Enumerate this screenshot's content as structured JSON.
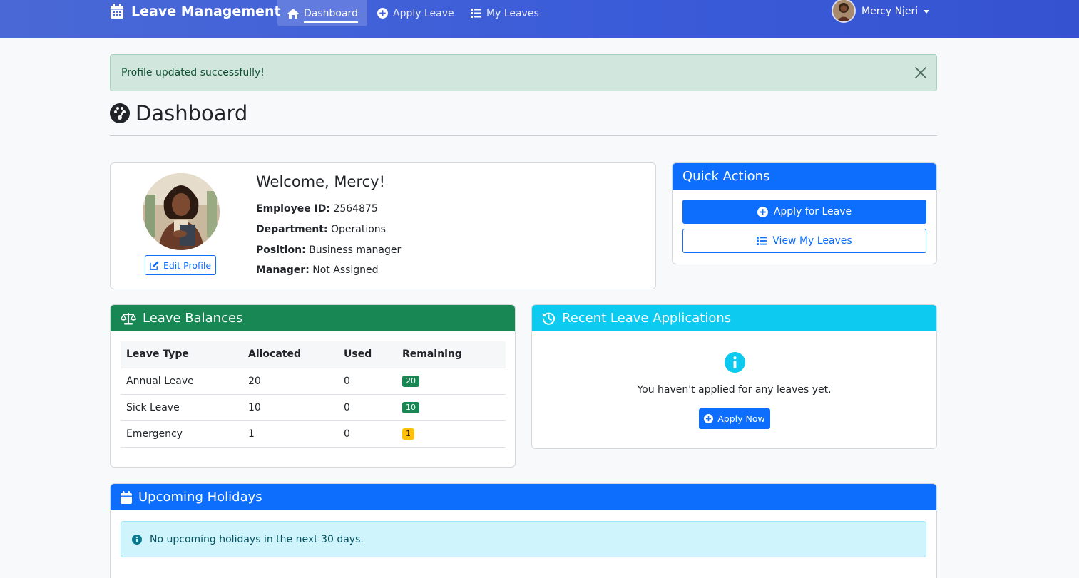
{
  "navbar": {
    "brand": "Leave Management",
    "items": [
      {
        "label": "Dashboard",
        "active": true
      },
      {
        "label": "Apply Leave"
      },
      {
        "label": "My Leaves"
      }
    ],
    "user_name": "Mercy Njeri"
  },
  "alert": {
    "message": "Profile updated successfully!"
  },
  "page": {
    "title": "Dashboard"
  },
  "profile": {
    "welcome": "Welcome, Mercy!",
    "edit_label": "Edit Profile",
    "fields": [
      {
        "label": "Employee ID:",
        "value": "2564875"
      },
      {
        "label": "Department:",
        "value": "Operations"
      },
      {
        "label": "Position:",
        "value": "Business manager"
      },
      {
        "label": "Manager:",
        "value": "Not Assigned"
      }
    ]
  },
  "quick_actions": {
    "title": "Quick Actions",
    "apply_label": "Apply for Leave",
    "view_label": "View My Leaves"
  },
  "leave_balances": {
    "title": "Leave Balances",
    "columns": [
      "Leave Type",
      "Allocated",
      "Used",
      "Remaining"
    ],
    "rows": [
      {
        "type": "Annual Leave",
        "allocated": "20",
        "used": "0",
        "remaining": "20",
        "status": "green"
      },
      {
        "type": "Sick Leave",
        "allocated": "10",
        "used": "0",
        "remaining": "10",
        "status": "green"
      },
      {
        "type": "Emergency",
        "allocated": "1",
        "used": "0",
        "remaining": "1",
        "status": "yellow"
      }
    ]
  },
  "recent_leaves": {
    "title": "Recent Leave Applications",
    "empty_message": "You haven't applied for any leaves yet.",
    "apply_now_label": "Apply Now"
  },
  "holidays": {
    "title": "Upcoming Holidays",
    "message": "No upcoming holidays in the next 30 days."
  },
  "colors": {
    "navbar": "#3a5bd9",
    "primary": "#0d6efd",
    "success": "#198754",
    "info": "#0dcaf0",
    "warning": "#ffc107"
  }
}
